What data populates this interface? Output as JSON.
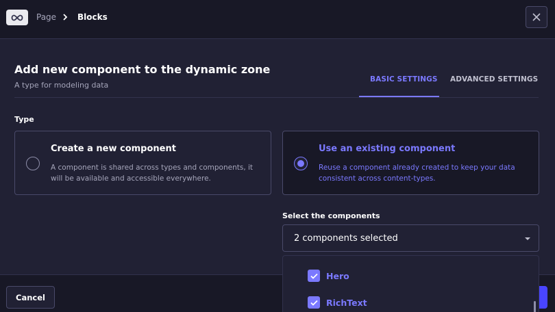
{
  "header": {
    "logo_icon": "infinity-icon",
    "breadcrumb": {
      "page": "Page",
      "separator_icon": "chevron-right-icon",
      "current": "Blocks"
    },
    "close_icon": "close-icon"
  },
  "modal": {
    "title": "Add new component to the dynamic zone",
    "subtitle": "A type for modeling data",
    "tabs": [
      {
        "label": "BASIC SETTINGS",
        "active": true
      },
      {
        "label": "ADVANCED SETTINGS",
        "active": false
      }
    ],
    "type_label": "Type",
    "options": [
      {
        "title": "Create a new component",
        "description": "A component is shared across types and components, it will be available and accessible everywhere.",
        "selected": false
      },
      {
        "title": "Use an existing component",
        "description": "Reuse a component already created to keep your data consistent across content-types.",
        "selected": true
      }
    ],
    "select": {
      "label": "Select the components",
      "value": "2 components selected",
      "caret_icon": "caret-down-icon",
      "items": [
        {
          "label": "Hero",
          "checked": true
        },
        {
          "label": "RichText",
          "checked": true
        }
      ]
    }
  },
  "footer": {
    "cancel_label": "Cancel"
  },
  "colors": {
    "accent": "#7b79ff",
    "primary_button": "#4945ff",
    "background": "#212134",
    "surface": "#181826",
    "border": "#4a4a6a"
  }
}
